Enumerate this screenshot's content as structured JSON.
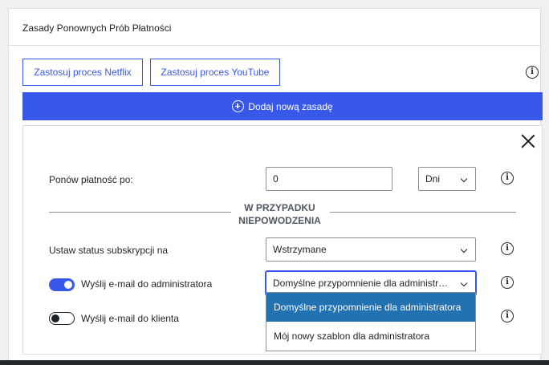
{
  "panel": {
    "title": "Zasady Ponownych Prób Płatności"
  },
  "templates": {
    "netflix_label": "Zastosuj proces Netflix",
    "youtube_label": "Zastosuj proces YouTube",
    "info_icon": "info-icon"
  },
  "add_rule": {
    "label": "Dodaj nową zasadę",
    "icon": "plus-circle-icon"
  },
  "rule": {
    "retry_label": "Ponów płatność po:",
    "retry_value": "0",
    "retry_unit": "Dni",
    "divider": "W PRZYPADKU NIEPOWODZENIA",
    "status_label": "Ustaw status subskrypcji na",
    "status_value": "Wstrzymane",
    "admin_email_label": "Wyślij e-mail do administratora",
    "admin_email_enabled": true,
    "admin_template_value": "Domyślne przypomnienie dla administratora",
    "client_email_label": "Wyślij e-mail do klienta",
    "client_email_enabled": false
  },
  "dropdown": {
    "options": [
      "Domyślne przypomnienie dla administratora",
      "Mój nowy szablon dla administratora"
    ],
    "highlighted_index": 0
  },
  "colors": {
    "accent": "#3858e9",
    "highlight": "#2271b1"
  }
}
